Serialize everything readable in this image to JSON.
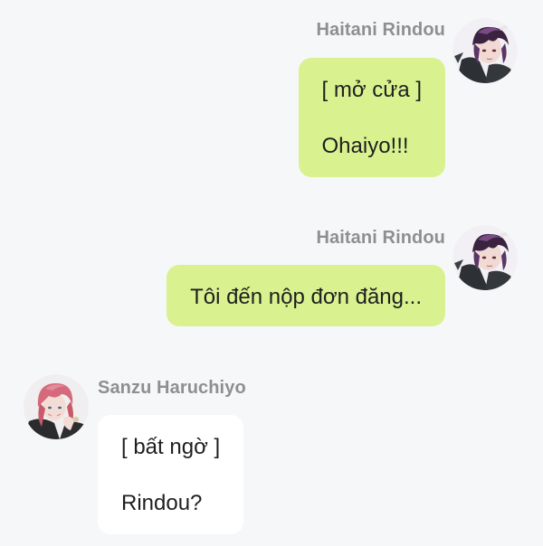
{
  "messages": [
    {
      "sender": "Haitani Rindou",
      "side": "right",
      "avatar_icon": "avatar-purple-hair-icon",
      "lines": [
        "[ mở cửa ]",
        "Ohaiyo!!!"
      ]
    },
    {
      "sender": "Haitani Rindou",
      "side": "right",
      "avatar_icon": "avatar-purple-hair-icon",
      "lines": [
        "Tôi đến nộp đơn đăng..."
      ]
    },
    {
      "sender": "Sanzu Haruchiyo",
      "side": "left",
      "avatar_icon": "avatar-pink-hair-icon",
      "lines": [
        "[ bất ngờ ]",
        "Rindou?"
      ]
    }
  ],
  "colors": {
    "background": "#f6f7f9",
    "outgoing_bubble": "#d9f28f",
    "incoming_bubble": "#ffffff",
    "sender_name": "#8f8f8f",
    "message_text": "#1f1f1f"
  }
}
